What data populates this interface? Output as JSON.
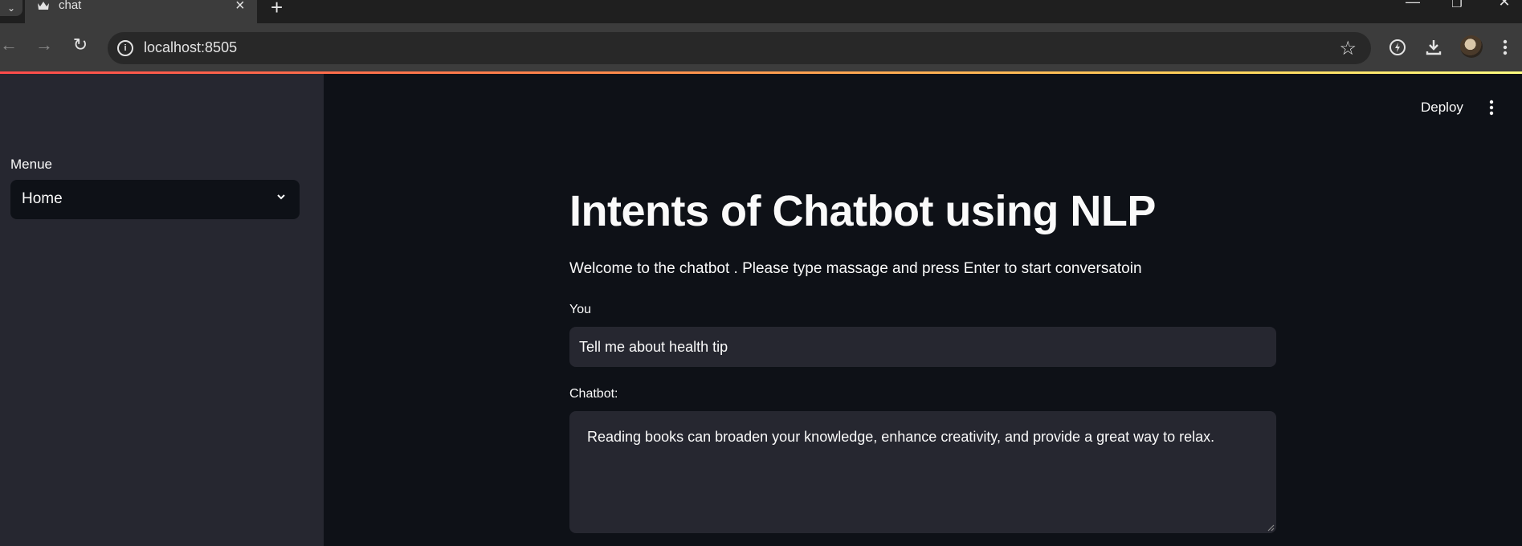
{
  "browser": {
    "tab_title": "chat",
    "url": "localhost:8505",
    "icons": {
      "tab_scroll": "chevron-down-icon",
      "favicon": "crown-icon",
      "tab_close": "close-icon",
      "new_tab": "plus-icon",
      "back": "arrow-left-icon",
      "forward": "arrow-right-icon",
      "reload": "reload-icon",
      "site_info": "info-icon",
      "bookmark": "star-icon",
      "performance": "lightning-icon",
      "downloads": "download-icon",
      "more": "kebab-icon"
    }
  },
  "sidebar": {
    "label": "Menue",
    "select_value": "Home"
  },
  "header": {
    "deploy_label": "Deploy"
  },
  "main": {
    "title": "Intents of Chatbot using NLP",
    "welcome": "Welcome to the chatbot . Please type massage and press Enter to start conversatoin",
    "you_label": "You",
    "you_value": "Tell me about health tip",
    "chatbot_label": "Chatbot:",
    "chatbot_value": "Reading books can broaden your knowledge, enhance creativity, and provide a great way to relax."
  },
  "colors": {
    "app_bg": "#0e1117",
    "sidebar_bg": "#262730",
    "input_bg": "#262730",
    "text": "#fafafa",
    "accent_gradient_start": "#ff4b4b",
    "accent_gradient_end": "#fffd80"
  }
}
